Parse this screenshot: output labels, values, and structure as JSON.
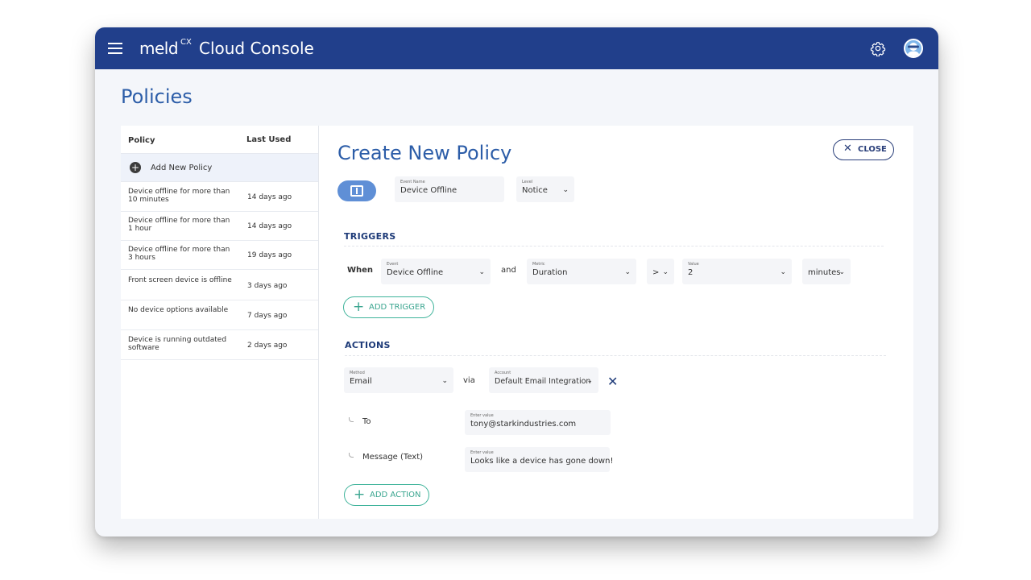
{
  "app": {
    "brand_logo": "meld",
    "brand_logo_sup": "CX",
    "title": "Cloud Console"
  },
  "page": {
    "title": "Policies"
  },
  "policy_list": {
    "col_policy": "Policy",
    "col_last_used": "Last Used",
    "add_label": "Add New Policy",
    "rows": [
      {
        "name": "Device offline for more than 10 minutes",
        "last_used": "14 days ago"
      },
      {
        "name": "Device offline for more than 1 hour",
        "last_used": "14 days ago"
      },
      {
        "name": "Device offline for more than 3 hours",
        "last_used": "19 days ago"
      },
      {
        "name": "Front screen device is offline",
        "last_used": "3 days ago"
      },
      {
        "name": "No device options available",
        "last_used": "7 days ago"
      },
      {
        "name": "Device is running outdated software",
        "last_used": "2 days ago"
      }
    ]
  },
  "editor": {
    "title": "Create New Policy",
    "close_label": "CLOSE",
    "event_name_label": "Event Name",
    "event_name_value": "Device Offline",
    "level_label": "Level",
    "level_value": "Notice",
    "triggers": {
      "heading": "TRIGGERS",
      "when": "When",
      "event_label": "Event",
      "event_value": "Device Offline",
      "and": "and",
      "metric_label": "Metric",
      "metric_value": "Duration",
      "operator_value": ">",
      "value_label": "Value",
      "value_value": "2",
      "unit_value": "minutes",
      "add_label": "ADD TRIGGER"
    },
    "actions": {
      "heading": "ACTIONS",
      "method_label": "Method",
      "method_value": "Email",
      "via": "via",
      "account_label": "Account",
      "account_value": "Default Email Integration",
      "to_label": "To",
      "to_field_label": "Enter value",
      "to_value": "tony@starkindustries.com",
      "message_label": "Message (Text)",
      "message_field_label": "Enter value",
      "message_value": "Looks like a device has gone down!",
      "add_label": "ADD ACTION"
    }
  },
  "icons": {
    "menu": "hamburger-icon",
    "settings": "gear-icon",
    "user": "avatar",
    "event": "event-type-icon",
    "close": "close-icon",
    "add": "plus-icon",
    "remove": "x-icon",
    "dropdown": "chevron-down-icon"
  },
  "colors": {
    "topbar": "#213f8b",
    "accent_blue": "#2c5da8",
    "accent_green": "#3eb39a",
    "pill_blue": "#5f8fd6"
  }
}
